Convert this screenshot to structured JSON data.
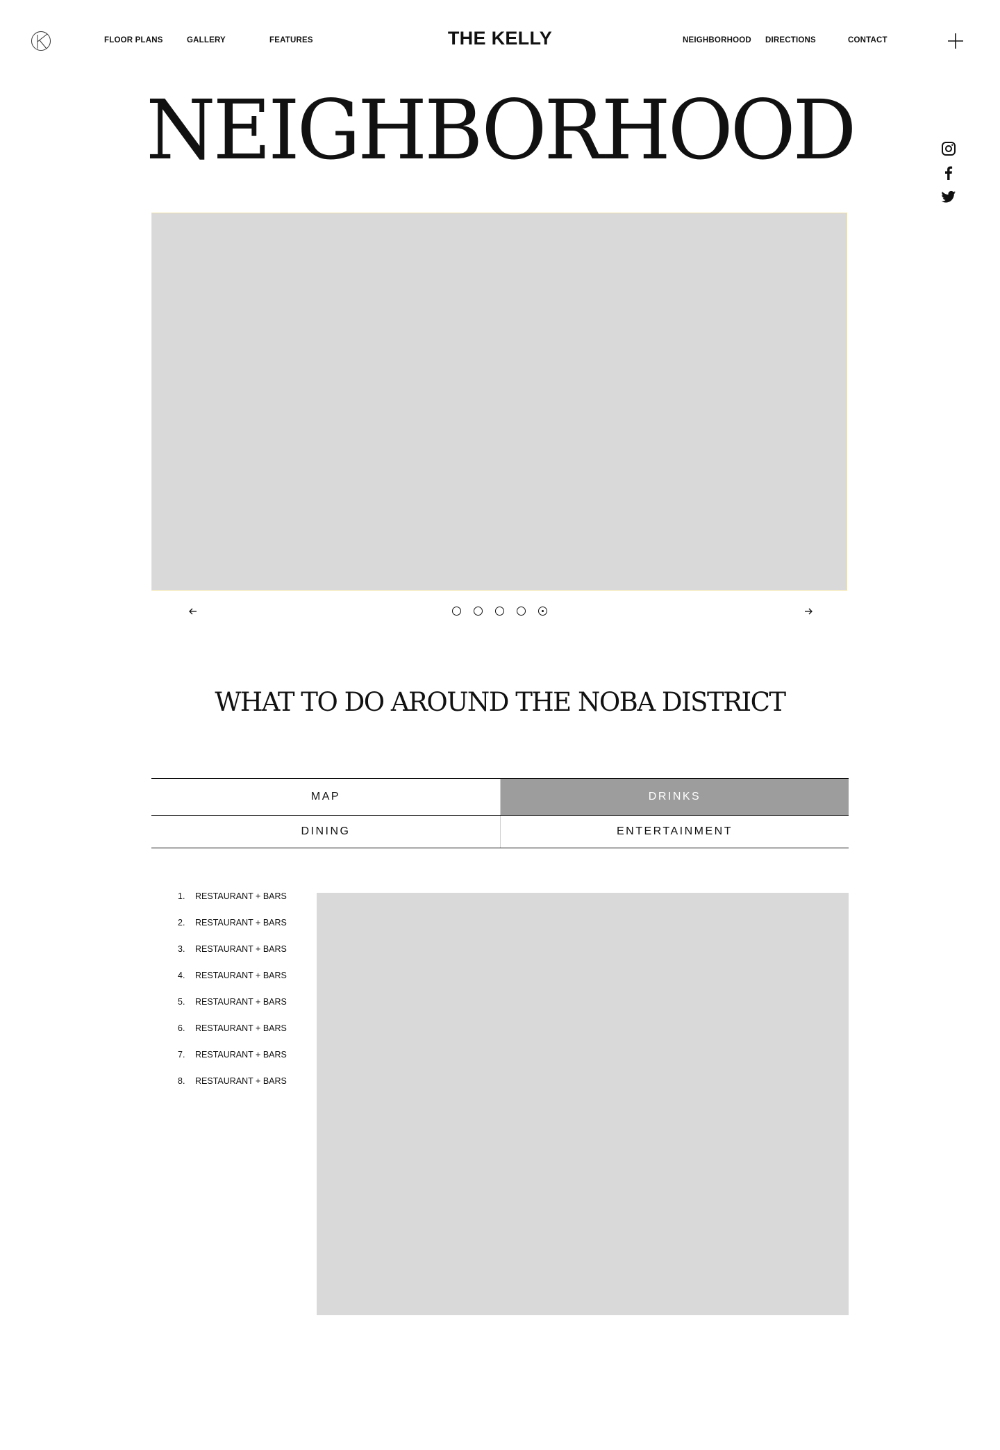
{
  "header": {
    "brand": "THE KELLY",
    "nav_left": [
      "FLOOR PLANS",
      "GALLERY",
      "FEATURES"
    ],
    "nav_right": [
      "NEIGHBORHOOD",
      "DIRECTIONS",
      "CONTACT"
    ],
    "logo_icon": "circle-k-logo-icon",
    "menu_icon": "plus-icon"
  },
  "hero": {
    "title": "NEIGHBORHOOD"
  },
  "social": [
    "instagram-icon",
    "facebook-icon",
    "twitter-icon"
  ],
  "carousel": {
    "slide_count": 5,
    "active_index": 4,
    "prev_icon": "arrow-left-icon",
    "next_icon": "arrow-right-icon",
    "placeholder_color": "#d9d9d9"
  },
  "section": {
    "title": "WHAT TO DO AROUND THE NOBA DISTRICT"
  },
  "tabs": [
    {
      "label": "MAP",
      "active": false
    },
    {
      "label": "DRINKS",
      "active": true
    },
    {
      "label": "DINING",
      "active": false
    },
    {
      "label": "ENTERTAINMENT",
      "active": false
    }
  ],
  "list": {
    "items": [
      {
        "num": "1.",
        "label": "RESTAURANT + BARS"
      },
      {
        "num": "2.",
        "label": "RESTAURANT + BARS"
      },
      {
        "num": "3.",
        "label": "RESTAURANT + BARS"
      },
      {
        "num": "4.",
        "label": "RESTAURANT + BARS"
      },
      {
        "num": "5.",
        "label": "RESTAURANT + BARS"
      },
      {
        "num": "6.",
        "label": "RESTAURANT + BARS"
      },
      {
        "num": "7.",
        "label": "RESTAURANT + BARS"
      },
      {
        "num": "8.",
        "label": "RESTAURANT + BARS"
      }
    ]
  },
  "colors": {
    "active_tab": "#9d9d9d",
    "placeholder": "#d9d9d9",
    "text": "#111111"
  }
}
